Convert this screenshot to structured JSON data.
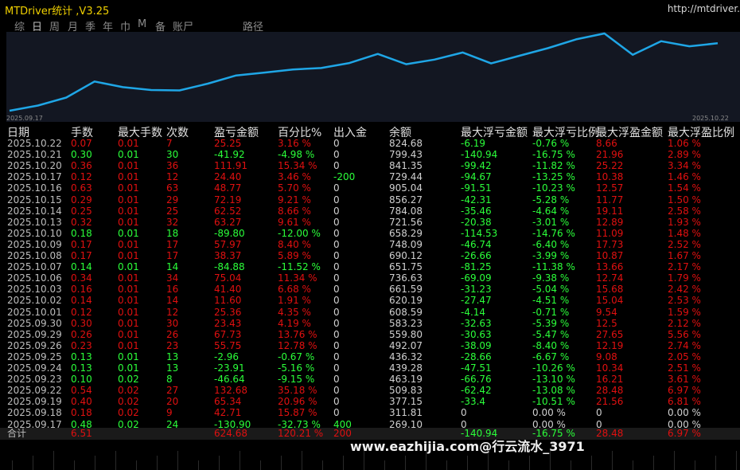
{
  "app": {
    "title": "MTDriver统计 ,V3.25",
    "url": "http://mtdriver."
  },
  "tabs": [
    "综",
    "日",
    "周",
    "月",
    "季",
    "年",
    "巾",
    "M",
    "备",
    "账尸",
    "路径"
  ],
  "chart_data": {
    "type": "line",
    "x_start": "2025.09.17",
    "x_end": "2025.10.22",
    "x": [
      "2025.09.17",
      "2025.09.18",
      "2025.09.19",
      "2025.09.22",
      "2025.09.23",
      "2025.09.24",
      "2025.09.25",
      "2025.09.26",
      "2025.09.29",
      "2025.09.30",
      "2025.10.01",
      "2025.10.02",
      "2025.10.03",
      "2025.10.06",
      "2025.10.07",
      "2025.10.08",
      "2025.10.09",
      "2025.10.10",
      "2025.10.13",
      "2025.10.14",
      "2025.10.15",
      "2025.10.16",
      "2025.10.17",
      "2025.10.20",
      "2025.10.21",
      "2025.10.22"
    ],
    "series": [
      {
        "values": [
          269.1,
          311.81,
          377.15,
          509.83,
          463.19,
          439.28,
          436.32,
          492.07,
          559.8,
          583.23,
          608.59,
          620.19,
          661.59,
          736.63,
          651.75,
          690.12,
          748.09,
          658.29,
          721.56,
          784.08,
          856.27,
          905.04,
          729.44,
          841.35,
          799.43,
          824.68
        ]
      }
    ],
    "color": "#1fa6e6"
  },
  "table": {
    "headers": [
      "日期",
      "手数",
      "最大手数",
      "次数",
      "盈亏金额",
      "百分比%",
      "出入金",
      "余额",
      "最大浮亏金额",
      "最大浮亏比例",
      "最大浮盈金额",
      "最大浮盈比例"
    ],
    "rows": [
      [
        "2025.10.22",
        "0.07",
        "0.01",
        "7",
        "25.25",
        "3.16 %",
        "0",
        "824.68",
        "-6.19",
        "-0.76 %",
        "8.66",
        "1.06 %"
      ],
      [
        "2025.10.21",
        "0.30",
        "0.01",
        "30",
        "-41.92",
        "-4.98 %",
        "0",
        "799.43",
        "-140.94",
        "-16.75 %",
        "21.96",
        "2.89 %"
      ],
      [
        "2025.10.20",
        "0.36",
        "0.01",
        "36",
        "111.91",
        "15.34 %",
        "0",
        "841.35",
        "-99.42",
        "-11.82 %",
        "25.22",
        "3.34 %"
      ],
      [
        "2025.10.17",
        "0.12",
        "0.01",
        "12",
        "24.40",
        "3.46 %",
        "-200",
        "729.44",
        "-94.67",
        "-13.25 %",
        "10.38",
        "1.46 %"
      ],
      [
        "2025.10.16",
        "0.63",
        "0.01",
        "63",
        "48.77",
        "5.70 %",
        "0",
        "905.04",
        "-91.51",
        "-10.23 %",
        "12.57",
        "1.54 %"
      ],
      [
        "2025.10.15",
        "0.29",
        "0.01",
        "29",
        "72.19",
        "9.21 %",
        "0",
        "856.27",
        "-42.31",
        "-5.28 %",
        "11.77",
        "1.50 %"
      ],
      [
        "2025.10.14",
        "0.25",
        "0.01",
        "25",
        "62.52",
        "8.66 %",
        "0",
        "784.08",
        "-35.46",
        "-4.64 %",
        "19.11",
        "2.58 %"
      ],
      [
        "2025.10.13",
        "0.32",
        "0.01",
        "32",
        "63.27",
        "9.61 %",
        "0",
        "721.56",
        "-20.38",
        "-3.01 %",
        "12.89",
        "1.93 %"
      ],
      [
        "2025.10.10",
        "0.18",
        "0.01",
        "18",
        "-89.80",
        "-12.00 %",
        "0",
        "658.29",
        "-114.53",
        "-14.76 %",
        "11.09",
        "1.48 %"
      ],
      [
        "2025.10.09",
        "0.17",
        "0.01",
        "17",
        "57.97",
        "8.40 %",
        "0",
        "748.09",
        "-46.74",
        "-6.40 %",
        "17.73",
        "2.52 %"
      ],
      [
        "2025.10.08",
        "0.17",
        "0.01",
        "17",
        "38.37",
        "5.89 %",
        "0",
        "690.12",
        "-26.66",
        "-3.99 %",
        "10.87",
        "1.67 %"
      ],
      [
        "2025.10.07",
        "0.14",
        "0.01",
        "14",
        "-84.88",
        "-11.52 %",
        "0",
        "651.75",
        "-81.25",
        "-11.38 %",
        "13.66",
        "2.17 %"
      ],
      [
        "2025.10.06",
        "0.34",
        "0.01",
        "34",
        "75.04",
        "11.34 %",
        "0",
        "736.63",
        "-69.09",
        "-9.38 %",
        "12.74",
        "1.79 %"
      ],
      [
        "2025.10.03",
        "0.16",
        "0.01",
        "16",
        "41.40",
        "6.68 %",
        "0",
        "661.59",
        "-31.23",
        "-5.04 %",
        "15.68",
        "2.42 %"
      ],
      [
        "2025.10.02",
        "0.14",
        "0.01",
        "14",
        "11.60",
        "1.91 %",
        "0",
        "620.19",
        "-27.47",
        "-4.51 %",
        "15.04",
        "2.53 %"
      ],
      [
        "2025.10.01",
        "0.12",
        "0.01",
        "12",
        "25.36",
        "4.35 %",
        "0",
        "608.59",
        "-4.14",
        "-0.71 %",
        "9.54",
        "1.59 %"
      ],
      [
        "2025.09.30",
        "0.30",
        "0.01",
        "30",
        "23.43",
        "4.19 %",
        "0",
        "583.23",
        "-32.63",
        "-5.39 %",
        "12.5",
        "2.12 %"
      ],
      [
        "2025.09.29",
        "0.26",
        "0.01",
        "26",
        "67.73",
        "13.76 %",
        "0",
        "559.80",
        "-30.63",
        "-5.47 %",
        "27.65",
        "5.56 %"
      ],
      [
        "2025.09.26",
        "0.23",
        "0.01",
        "23",
        "55.75",
        "12.78 %",
        "0",
        "492.07",
        "-38.09",
        "-8.40 %",
        "12.19",
        "2.74 %"
      ],
      [
        "2025.09.25",
        "0.13",
        "0.01",
        "13",
        "-2.96",
        "-0.67 %",
        "0",
        "436.32",
        "-28.66",
        "-6.67 %",
        "9.08",
        "2.05 %"
      ],
      [
        "2025.09.24",
        "0.13",
        "0.01",
        "13",
        "-23.91",
        "-5.16 %",
        "0",
        "439.28",
        "-47.51",
        "-10.26 %",
        "10.34",
        "2.51 %"
      ],
      [
        "2025.09.23",
        "0.10",
        "0.02",
        "8",
        "-46.64",
        "-9.15 %",
        "0",
        "463.19",
        "-66.76",
        "-13.10 %",
        "16.21",
        "3.61 %"
      ],
      [
        "2025.09.22",
        "0.54",
        "0.02",
        "27",
        "132.68",
        "35.18 %",
        "0",
        "509.83",
        "-62.42",
        "-13.08 %",
        "28.48",
        "6.97 %"
      ],
      [
        "2025.09.19",
        "0.40",
        "0.02",
        "20",
        "65.34",
        "20.96 %",
        "0",
        "377.15",
        "-33.4",
        "-10.51 %",
        "21.56",
        "6.81 %"
      ],
      [
        "2025.09.18",
        "0.18",
        "0.02",
        "9",
        "42.71",
        "15.87 %",
        "0",
        "311.81",
        "0",
        "0.00 %",
        "0",
        "0.00 %"
      ],
      [
        "2025.09.17",
        "0.48",
        "0.02",
        "24",
        "-130.90",
        "-32.73 %",
        "400",
        "269.10",
        "0",
        "0.00 %",
        "0",
        "0.00 %"
      ]
    ],
    "total": [
      "合计",
      "6.51",
      "",
      "",
      "624.68",
      "120.21 %",
      "200",
      "",
      "-140.94",
      "-16.75 %",
      "28.48",
      "6.97 %"
    ]
  },
  "watermark": "www.eazhijia.com@行云流水_3971",
  "colors": {
    "positive": "#2bff3a",
    "negative": "#e01010",
    "title": "#f0d000",
    "line": "#1fa6e6"
  }
}
